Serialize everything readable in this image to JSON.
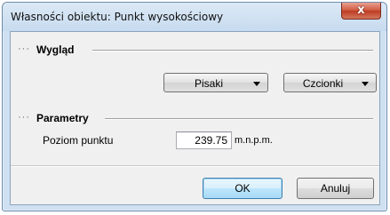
{
  "window": {
    "title": "Własności obiektu: Punkt wysokościowy",
    "close_symbol": "x"
  },
  "appearance": {
    "section_dots": "···",
    "section_title": "Wygląd",
    "pens_label": "Pisaki",
    "fonts_label": "Czcionki"
  },
  "parameters": {
    "section_dots": "···",
    "section_title": "Parametry",
    "level_label": "Poziom punktu",
    "level_value": "239.75",
    "level_unit": "m.n.p.m."
  },
  "actions": {
    "ok_label": "OK",
    "cancel_label": "Anuluj"
  }
}
